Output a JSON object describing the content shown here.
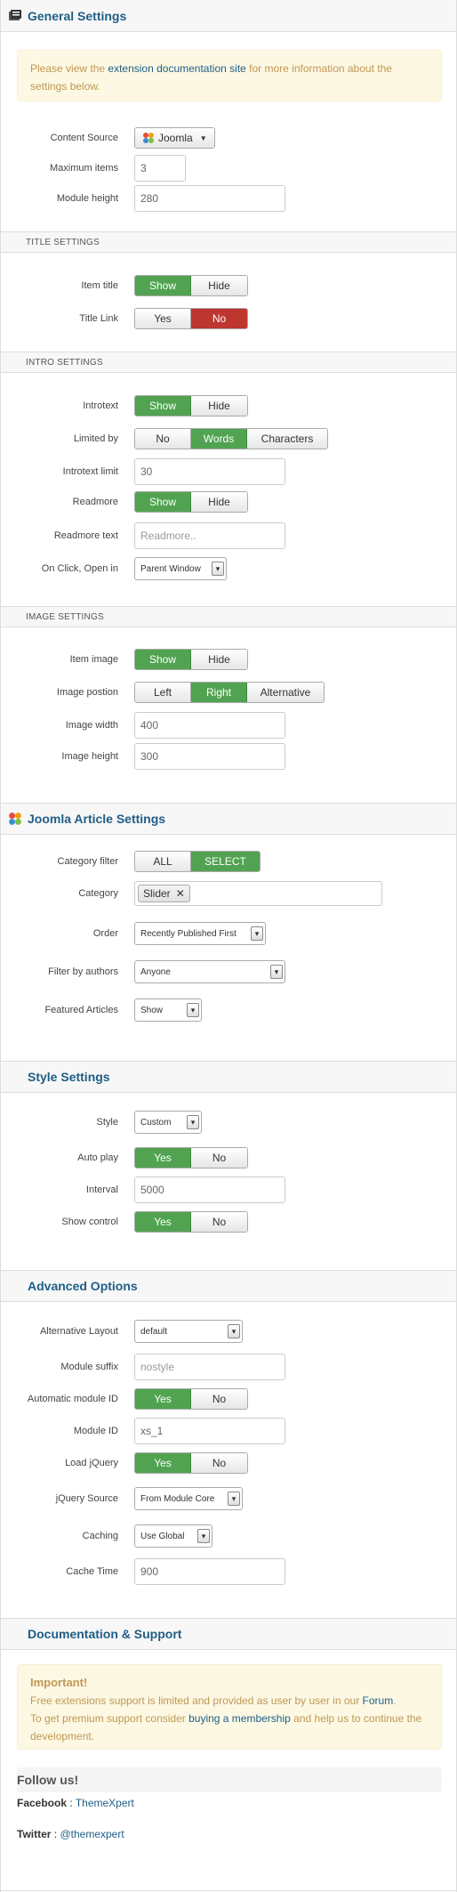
{
  "general": {
    "title": "General Settings",
    "notice_pre": "Please view the ",
    "notice_link": "extension documentation site",
    "notice_post": " for more information about the settings below.",
    "content_source_label": "Content Source",
    "content_source_value": "Joomla",
    "max_items_label": "Maximum items",
    "max_items_value": "3",
    "module_height_label": "Module height",
    "module_height_value": "280"
  },
  "title_settings": {
    "header": "TITLE SETTINGS",
    "item_title_label": "Item title",
    "item_title_opts": [
      "Show",
      "Hide"
    ],
    "title_link_label": "Title Link",
    "title_link_opts": [
      "Yes",
      "No"
    ]
  },
  "intro_settings": {
    "header": "INTRO SETTINGS",
    "introtext_label": "Introtext",
    "introtext_opts": [
      "Show",
      "Hide"
    ],
    "limited_by_label": "Limited by",
    "limited_by_opts": [
      "No",
      "Words",
      "Characters"
    ],
    "intro_limit_label": "Introtext limit",
    "intro_limit_value": "30",
    "readmore_label": "Readmore",
    "readmore_opts": [
      "Show",
      "Hide"
    ],
    "readmore_text_label": "Readmore text",
    "readmore_text_placeholder": "Readmore..",
    "on_click_label": "On Click, Open in",
    "on_click_value": "Parent Window"
  },
  "image_settings": {
    "header": "IMAGE SETTINGS",
    "item_image_label": "Item image",
    "item_image_opts": [
      "Show",
      "Hide"
    ],
    "image_position_label": "Image postion",
    "image_position_opts": [
      "Left",
      "Right",
      "Alternative"
    ],
    "image_width_label": "Image width",
    "image_width_value": "400",
    "image_height_label": "Image height",
    "image_height_value": "300"
  },
  "joomla_article": {
    "title": "Joomla Article Settings",
    "category_filter_label": "Category filter",
    "category_filter_opts": [
      "ALL",
      "SELECT"
    ],
    "category_label": "Category",
    "category_tag": "Slider",
    "order_label": "Order",
    "order_value": "Recently Published First",
    "filter_authors_label": "Filter by authors",
    "filter_authors_value": "Anyone",
    "featured_label": "Featured Articles",
    "featured_value": "Show"
  },
  "style_settings": {
    "title": "Style Settings",
    "style_label": "Style",
    "style_value": "Custom",
    "autoplay_label": "Auto play",
    "autoplay_opts": [
      "Yes",
      "No"
    ],
    "interval_label": "Interval",
    "interval_value": "5000",
    "show_control_label": "Show control",
    "show_control_opts": [
      "Yes",
      "No"
    ]
  },
  "advanced": {
    "title": "Advanced Options",
    "alt_layout_label": "Alternative Layout",
    "alt_layout_value": "default",
    "module_suffix_label": "Module suffix",
    "module_suffix_placeholder": "nostyle",
    "auto_module_id_label": "Automatic module ID",
    "auto_module_id_opts": [
      "Yes",
      "No"
    ],
    "module_id_label": "Module ID",
    "module_id_value": "xs_1",
    "load_jquery_label": "Load jQuery",
    "load_jquery_opts": [
      "Yes",
      "No"
    ],
    "jquery_source_label": "jQuery Source",
    "jquery_source_value": "From Module Core",
    "caching_label": "Caching",
    "caching_value": "Use Global",
    "cache_time_label": "Cache Time",
    "cache_time_value": "900"
  },
  "support": {
    "title": "Documentation & Support",
    "important": "Important!",
    "line1_pre": "Free extensions support is limited and provided as user by user in our ",
    "forum_link": "Forum",
    "line1_post": ".",
    "line2_pre": "To get premium support consider ",
    "membership_link": "buying a membership",
    "line2_post": " and help us to continue the development.",
    "follow": "Follow us!",
    "facebook_label": "Facebook",
    "facebook_sep": " : ",
    "facebook_link": "ThemeXpert",
    "twitter_label": "Twitter",
    "twitter_sep": " : ",
    "twitter_link": "@themexpert"
  },
  "colors": {
    "accent": "#1f5e86",
    "green": "#51a351",
    "red": "#bd362f"
  }
}
